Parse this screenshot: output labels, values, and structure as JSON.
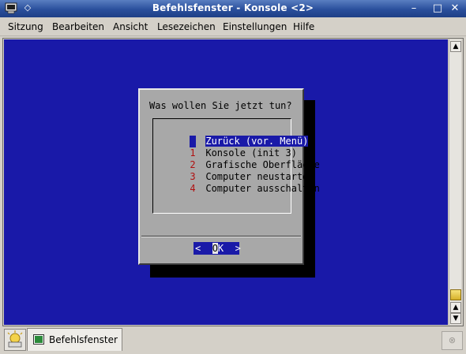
{
  "window": {
    "title": "Befehlsfenster - Konsole <2>",
    "buttons": {
      "minimize": "–",
      "maximize": "□",
      "close": "✕"
    },
    "pin": "◇"
  },
  "menu": [
    "Sitzung",
    "Bearbeiten",
    "Ansicht",
    "Lesezeichen",
    "Einstellungen",
    "Hilfe"
  ],
  "dialog": {
    "question": "Was wollen Sie jetzt tun?",
    "items": [
      {
        "tag": " ",
        "label": "Zurück (vor. Menü)",
        "selected": true
      },
      {
        "tag": "1",
        "label": "Konsole (init 3)"
      },
      {
        "tag": "2",
        "label": "Grafische Oberfläche"
      },
      {
        "tag": "3",
        "label": "Computer neustarten"
      },
      {
        "tag": "4",
        "label": "Computer ausschalten"
      }
    ],
    "ok_left": "<  ",
    "ok_hot": "O",
    "ok_right": "K  >"
  },
  "scrollbar": {
    "up": "▲",
    "down": "▼"
  },
  "tabbar": {
    "tab_label": "Befehlsfenster",
    "close_glyph": "⊗"
  },
  "colors": {
    "terminal_bg": "#1919a8",
    "dialog_bg": "#a8a8a8",
    "tag_red": "#b01010"
  }
}
